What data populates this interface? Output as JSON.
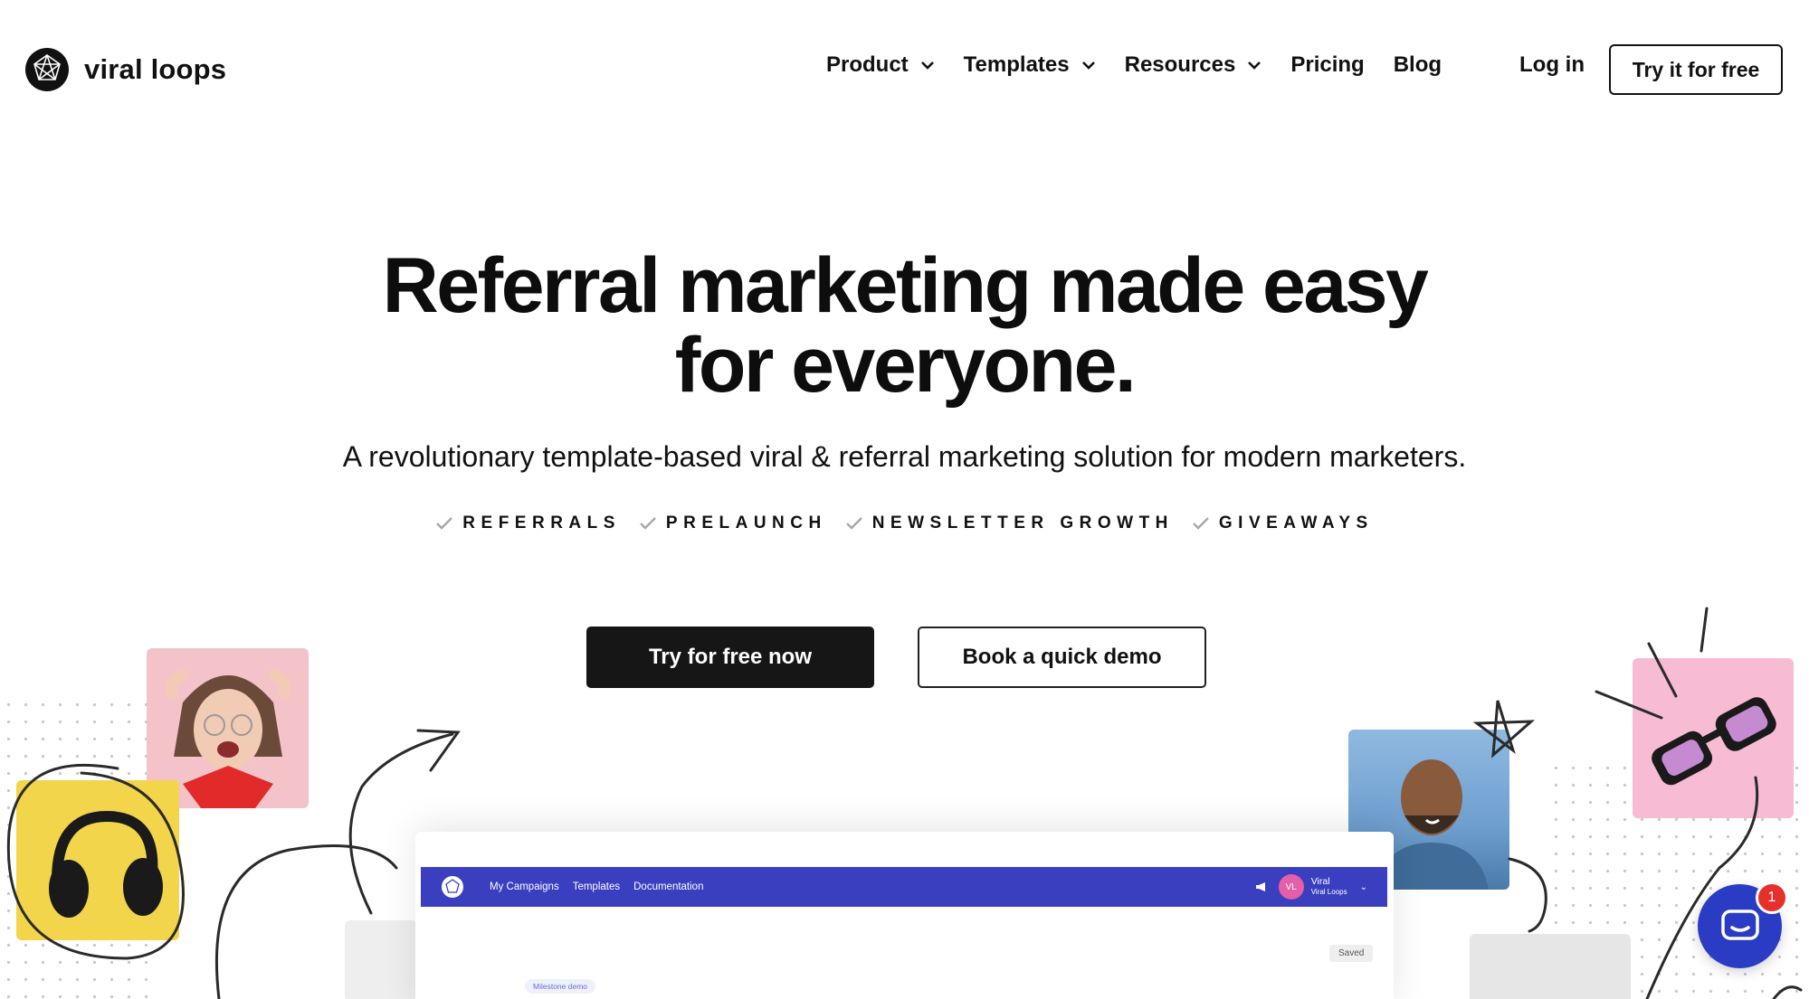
{
  "brand": {
    "name": "viral loops"
  },
  "nav": {
    "items": [
      {
        "label": "Product",
        "has_dropdown": true
      },
      {
        "label": "Templates",
        "has_dropdown": true
      },
      {
        "label": "Resources",
        "has_dropdown": true
      },
      {
        "label": "Pricing",
        "has_dropdown": false
      },
      {
        "label": "Blog",
        "has_dropdown": false
      }
    ],
    "login_label": "Log in",
    "try_label": "Try it for free"
  },
  "hero": {
    "title_line1": "Referral marketing made easy",
    "title_line2": "for everyone.",
    "subtitle": "A revolutionary template-based viral & referral marketing solution for modern marketers.",
    "tags": [
      "REFERRALS",
      "PRELAUNCH",
      "NEWSLETTER GROWTH",
      "GIVEAWAYS"
    ],
    "cta_primary": "Try for free now",
    "cta_secondary": "Book a quick demo"
  },
  "app_preview": {
    "links": [
      "My Campaigns",
      "Templates",
      "Documentation"
    ],
    "avatar_initials": "VL",
    "user_name": "Viral",
    "user_org": "Viral Loops",
    "saved_label": "Saved",
    "milestone_label": "Milestone demo"
  },
  "chat": {
    "unread_count": "1"
  },
  "colors": {
    "primary_dark": "#161616",
    "app_bar": "#3a3fc0",
    "chat_button": "#2b3cc4",
    "badge": "#e5302b",
    "avatar": "#e55ea8"
  }
}
